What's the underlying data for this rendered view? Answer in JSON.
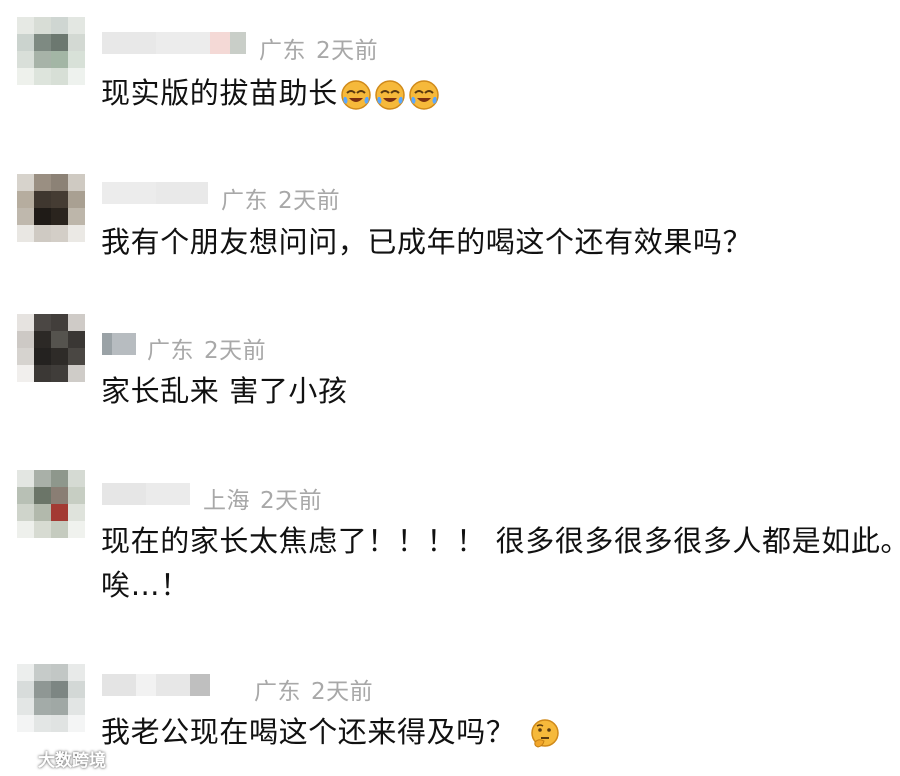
{
  "comments": [
    {
      "location": "广东",
      "time": "2天前",
      "text": "现实版的拔苗助长",
      "emoji": "laughing-crying-emoji"
    },
    {
      "location": "广东",
      "time": "2天前",
      "text": "我有个朋友想问问，已成年的喝这个还有效果吗？"
    },
    {
      "location": "广东",
      "time": "2天前",
      "text": "家长乱来 害了小孩"
    },
    {
      "location": "上海",
      "time": "2天前",
      "text_line1": "现在的家长太焦虑了！！！！ 很多很多很多很多人都是如此。",
      "text_line2": "唉…！"
    },
    {
      "location": "广东",
      "time": "2天前",
      "text": "我老公现在喝这个还来得及吗？",
      "emoji": "thinking-emoji"
    }
  ],
  "watermark": {
    "text": "大数跨境",
    "icon": "weibo-logo-icon"
  },
  "colors": {
    "meta_gray": "#a8a8a8",
    "text": "#111111",
    "emoji_yellow": "#f6b93b"
  }
}
